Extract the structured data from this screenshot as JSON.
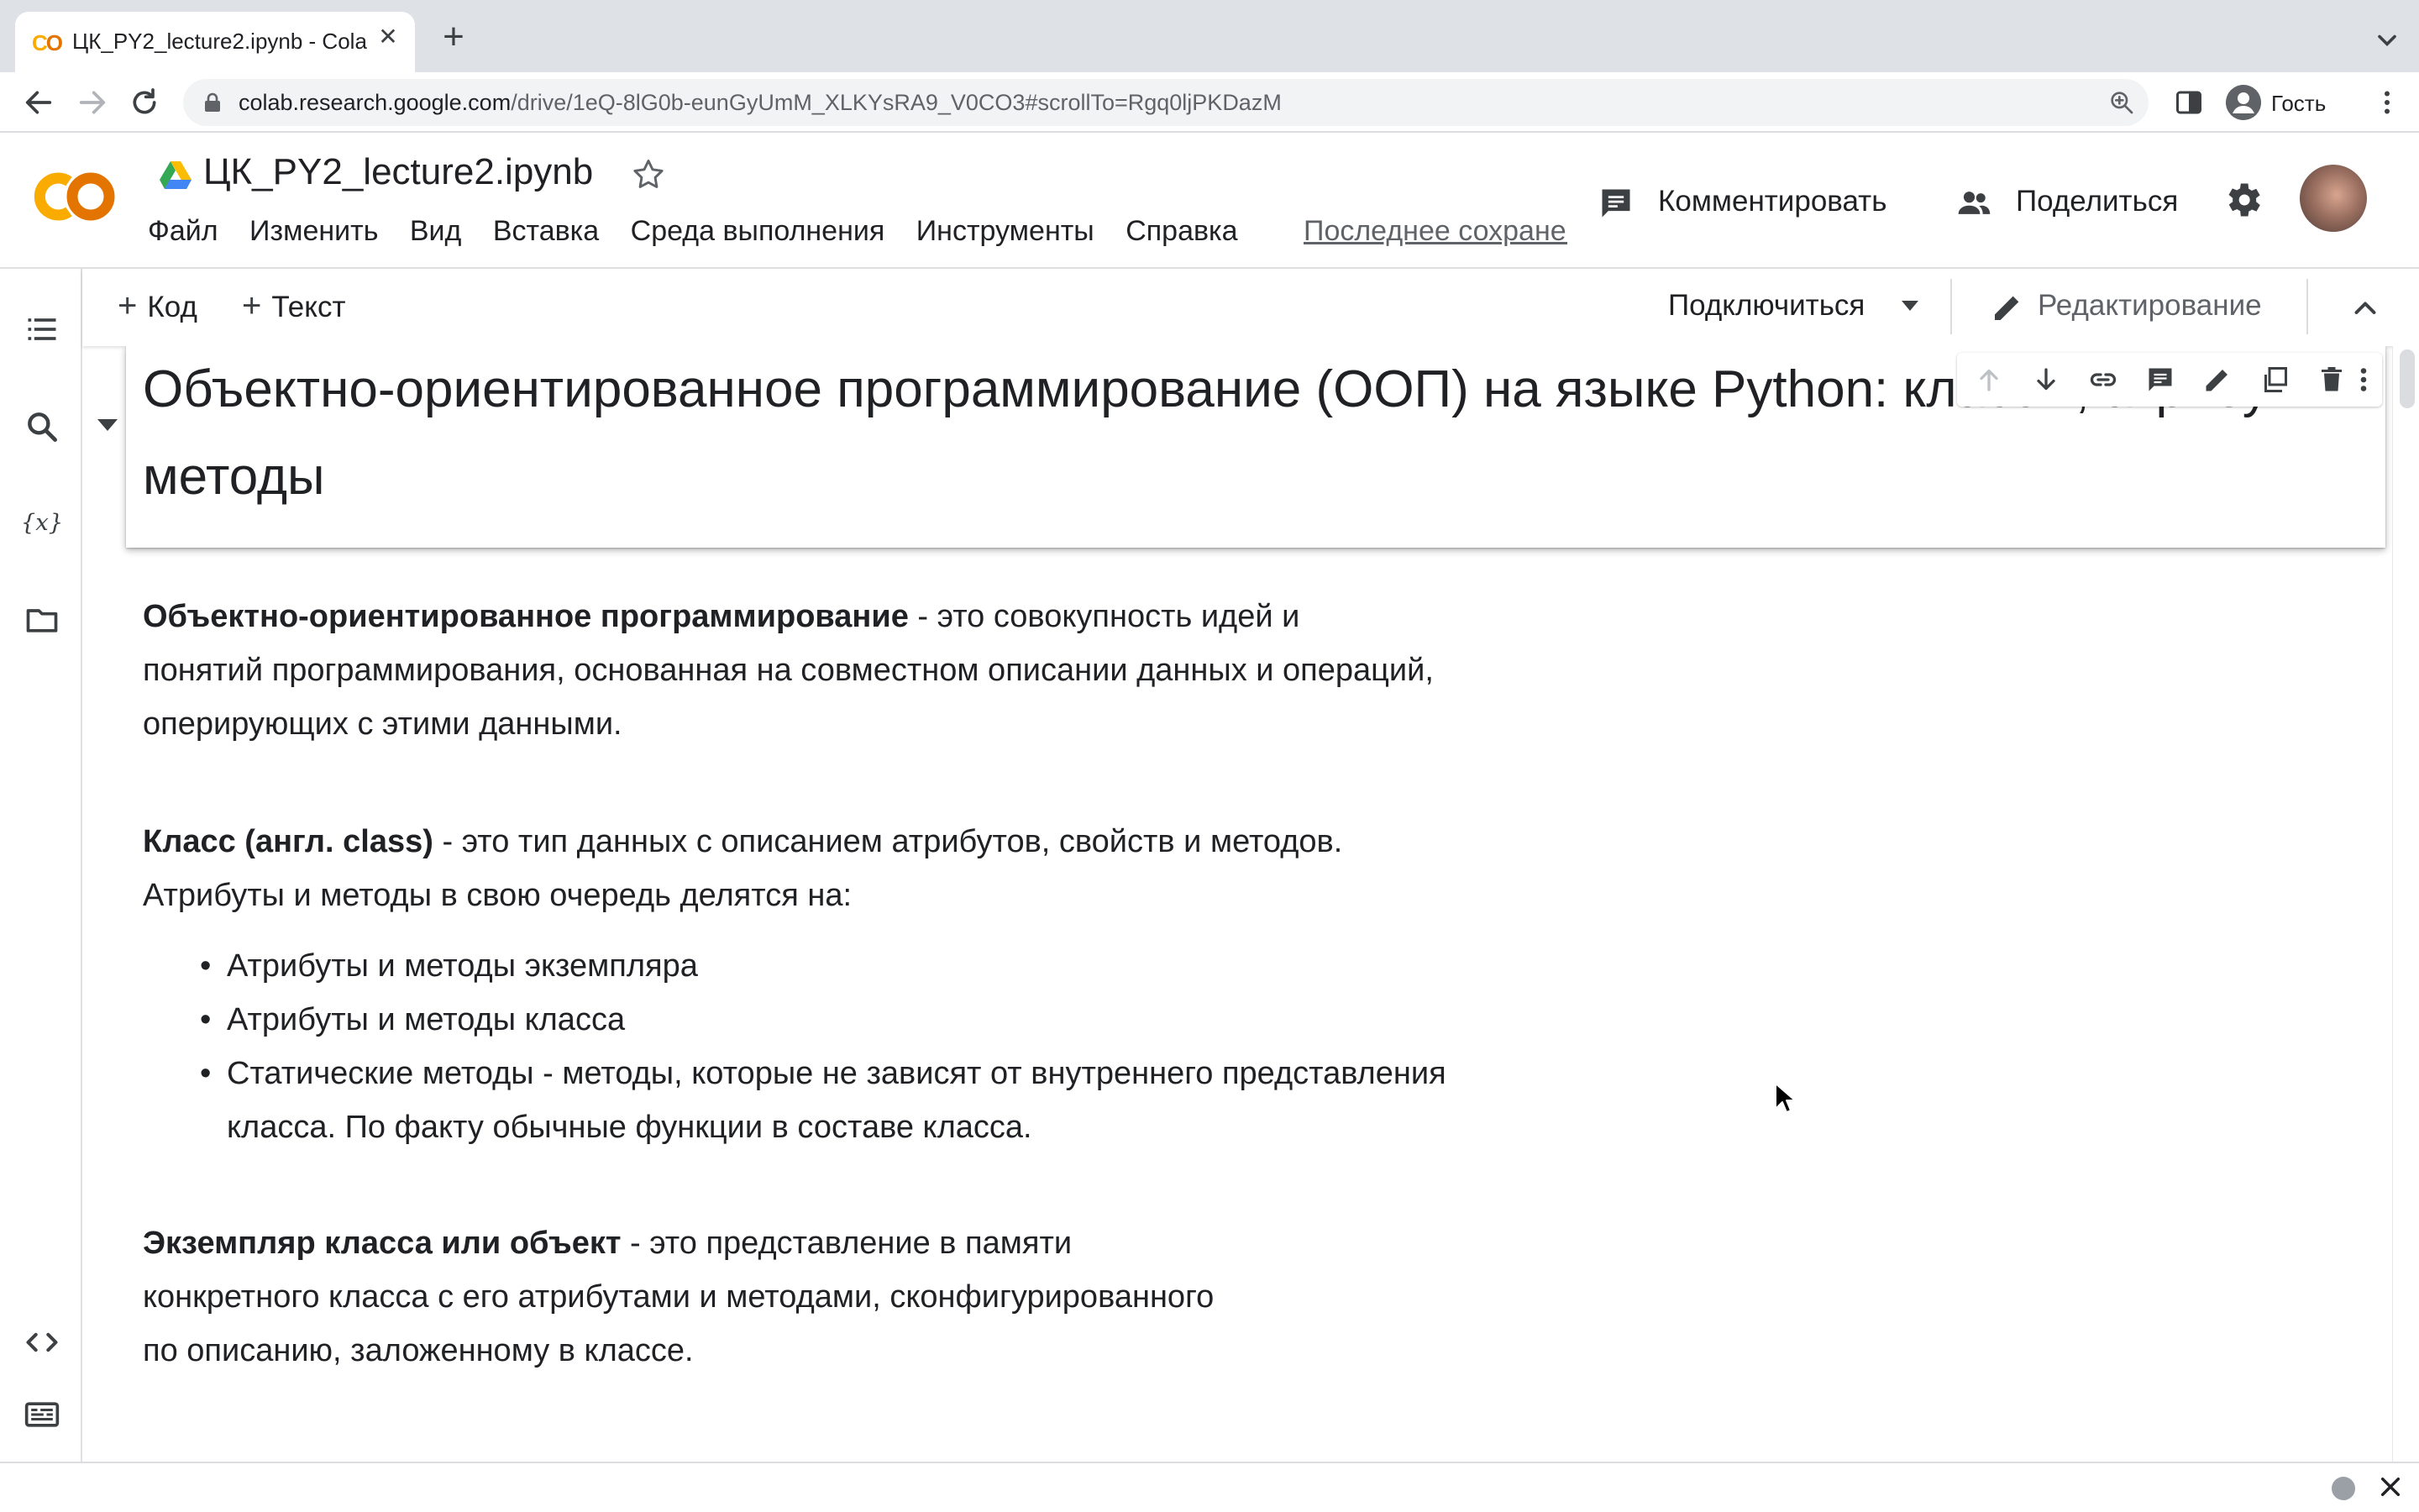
{
  "browser": {
    "tab_title": "ЦК_PY2_lecture2.ipynb - Colab",
    "favicon_text": "CO",
    "url_host": "colab.research.google.com",
    "url_path": "/drive/1eQ-8lG0b-eunGyUmM_XLKYsRA9_V0CO3#scrollTo=Rgq0ljPKDazM",
    "profile_label": "Гость"
  },
  "colab": {
    "notebook_title": "ЦК_PY2_lecture2.ipynb",
    "menu": [
      "Файл",
      "Изменить",
      "Вид",
      "Вставка",
      "Среда выполнения",
      "Инструменты",
      "Справка"
    ],
    "last_saved": "Последнее сохранение",
    "comment_label": "Комментировать",
    "share_label": "Поделиться"
  },
  "toolbar": {
    "add_code": "Код",
    "add_text": "Текст",
    "connect": "Подключиться",
    "edit_mode": "Редактирование"
  },
  "heading": "Объектно-ориентированное программирование (ООП) на языке Python: классы, атрибуты и методы",
  "paragraphs": {
    "oop": {
      "bold": "Объектно-ориентированное программирование",
      "line1": " - это совокупность идей и",
      "line2": "понятий программирования, основанная на совместном описании данных и операций,",
      "line3": "оперирующих с этими данными."
    },
    "class": {
      "bold": "Класс (англ. class)",
      "line1": " - это тип данных с описанием атрибутов, свойств и методов.",
      "line2": "Атрибуты и методы в свою очередь делятся на:",
      "bullets": [
        "Атрибуты и методы экземпляра",
        "Атрибуты и методы класса"
      ],
      "bullet3_line1": "Статические методы - методы, которые не зависят от внутреннего представления",
      "bullet3_line2": "класса. По факту обычные функции в составе класса."
    },
    "instance": {
      "bold": "Экземпляр класса или объект",
      "line1": " - это представление в памяти",
      "line2": "конкретного класса с его атрибутами и методами, сконфигурированного",
      "line3": "по описанию, заложенному в классе."
    }
  },
  "colors": {
    "chrome_bg": "#dee1e6",
    "colab_orange": "#f9ab00",
    "text": "#202124",
    "muted": "#5f6368"
  }
}
